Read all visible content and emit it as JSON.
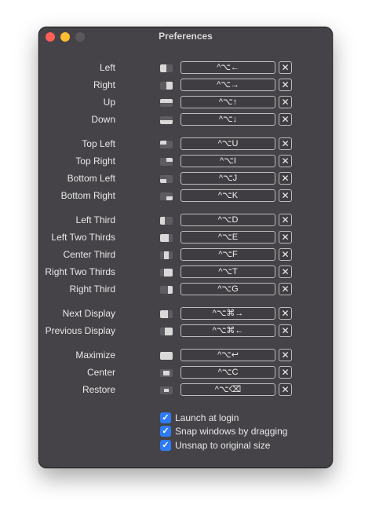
{
  "window": {
    "title": "Preferences"
  },
  "shortcuts": [
    {
      "label": "Left",
      "keys": "^⌥←",
      "icon": "left-half-icon"
    },
    {
      "label": "Right",
      "keys": "^⌥→",
      "icon": "right-half-icon"
    },
    {
      "label": "Up",
      "keys": "^⌥↑",
      "icon": "top-half-icon"
    },
    {
      "label": "Down",
      "keys": "^⌥↓",
      "icon": "bottom-half-icon"
    },
    {
      "label": "Top Left",
      "keys": "^⌥U",
      "icon": "top-left-quarter-icon"
    },
    {
      "label": "Top Right",
      "keys": "^⌥I",
      "icon": "top-right-quarter-icon"
    },
    {
      "label": "Bottom Left",
      "keys": "^⌥J",
      "icon": "bottom-left-quarter-icon"
    },
    {
      "label": "Bottom Right",
      "keys": "^⌥K",
      "icon": "bottom-right-quarter-icon"
    },
    {
      "label": "Left Third",
      "keys": "^⌥D",
      "icon": "left-third-icon"
    },
    {
      "label": "Left Two Thirds",
      "keys": "^⌥E",
      "icon": "left-two-thirds-icon"
    },
    {
      "label": "Center Third",
      "keys": "^⌥F",
      "icon": "center-third-icon"
    },
    {
      "label": "Right Two Thirds",
      "keys": "^⌥T",
      "icon": "right-two-thirds-icon"
    },
    {
      "label": "Right Third",
      "keys": "^⌥G",
      "icon": "right-third-icon"
    },
    {
      "label": "Next Display",
      "keys": "^⌥⌘→",
      "icon": "next-display-icon"
    },
    {
      "label": "Previous Display",
      "keys": "^⌥⌘←",
      "icon": "previous-display-icon"
    },
    {
      "label": "Maximize",
      "keys": "^⌥↩",
      "icon": "maximize-icon"
    },
    {
      "label": "Center",
      "keys": "^⌥C",
      "icon": "center-icon"
    },
    {
      "label": "Restore",
      "keys": "^⌥⌫",
      "icon": "restore-icon"
    }
  ],
  "clear_symbol": "✕",
  "options": [
    {
      "label": "Launch at login",
      "checked": true
    },
    {
      "label": "Snap windows by dragging",
      "checked": true
    },
    {
      "label": "Unsnap to original size",
      "checked": true
    }
  ],
  "check_glyph": "✓",
  "colors": {
    "accent": "#2f7bf5",
    "window_bg": "#454347",
    "close": "#ff5f57",
    "minimize": "#febc2e"
  }
}
